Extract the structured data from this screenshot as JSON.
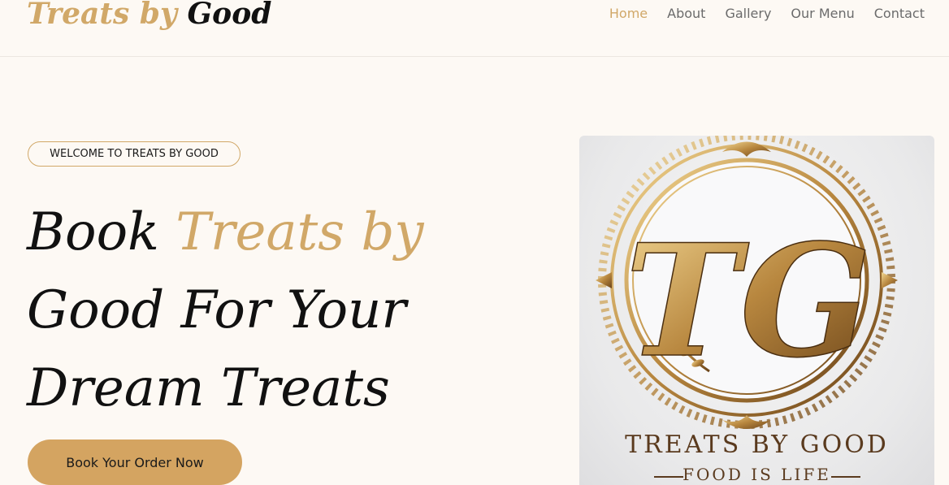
{
  "header": {
    "logo_part1": "Treats by",
    "logo_part2": "Good",
    "nav": [
      {
        "label": "Home",
        "active": true
      },
      {
        "label": "About"
      },
      {
        "label": "Gallery"
      },
      {
        "label": "Our Menu"
      },
      {
        "label": "Contact"
      }
    ]
  },
  "hero": {
    "badge": "WELCOME TO TREATS BY GOOD",
    "title_part1": "Book",
    "title_highlight": "Treats by",
    "title_part2": "Good For Your Dream Treats",
    "cta_label": "Book Your Order Now",
    "image": {
      "monogram": "TG",
      "brand_name": "TREATS BY GOOD",
      "tagline": "FOOD IS LIFE"
    }
  },
  "colors": {
    "accent": "#d1a868",
    "button": "#d4a461",
    "background": "#fdf9f4",
    "text": "#111111"
  }
}
